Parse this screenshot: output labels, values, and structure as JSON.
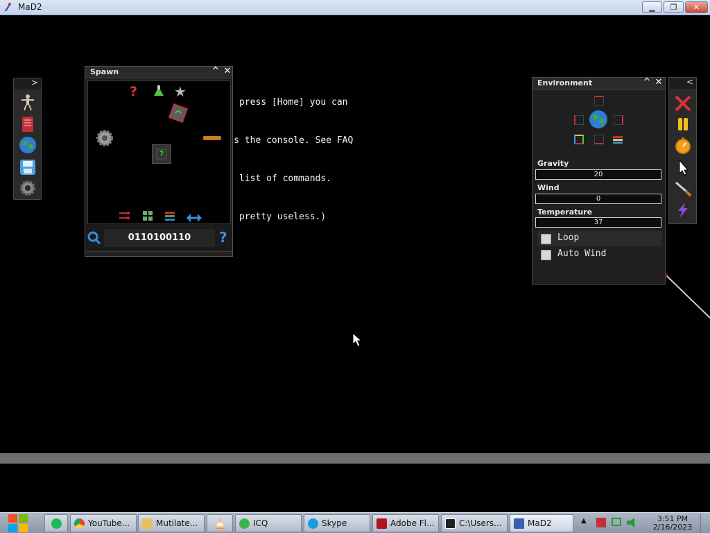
{
  "window": {
    "title": "MaD2",
    "minimize_label": "▁",
    "restore_label": "❐",
    "close_label": "✕"
  },
  "console_hint": {
    "lines": [
      "   ou press [Home] you can",
      "access the console. See FAQ",
      "for a list of commands.",
      "(It's pretty useless.)"
    ]
  },
  "left_toolbar": {
    "collapse_glyph": ">",
    "tools": [
      "ragdoll-tool-icon",
      "notebook-icon",
      "globe-icon",
      "save-disk-icon",
      "gear-icon"
    ]
  },
  "spawn_panel": {
    "title": "Spawn",
    "minimize_glyph": "^",
    "close_glyph": "✕",
    "search_code": "0110100110",
    "help_glyph": "?",
    "spawn_items": [
      "random-question-icon",
      "potion-flask-icon",
      "star-icon",
      "dice-box-icon",
      "gear-object-icon",
      "stick-object-icon",
      "mystery-box-icon"
    ],
    "footer_buttons": [
      "shuffle-icon",
      "grid-icon",
      "list-icon",
      "swap-arrows-icon"
    ]
  },
  "environment_panel": {
    "title": "Environment",
    "minimize_glyph": "^",
    "close_glyph": "✕",
    "gravity_label": "Gravity",
    "gravity_value": "20",
    "wind_label": "Wind",
    "wind_value": "0",
    "temperature_label": "Temperature",
    "temperature_value": "37",
    "loop_label": "Loop",
    "auto_wind_label": "Auto Wind"
  },
  "right_toolbar": {
    "collapse_glyph": "<",
    "tools": [
      "delete-x-icon",
      "pause-icon",
      "stopwatch-icon",
      "pointer-cursor-icon",
      "knife-icon",
      "lightning-icon"
    ]
  },
  "taskbar": {
    "items": [
      {
        "label": "",
        "icon": "spotify-icon",
        "color": "#1db954"
      },
      {
        "label": "YouTube...",
        "icon": "chrome-icon",
        "color": "#dd4b39"
      },
      {
        "label": "Mutilate...",
        "icon": "folder-icon",
        "color": "#e6c35a"
      },
      {
        "label": "",
        "icon": "vlc-icon",
        "color": "#f08a1c"
      },
      {
        "label": "ICQ",
        "icon": "icq-icon",
        "color": "#39b54a"
      },
      {
        "label": "Skype",
        "icon": "skype-icon",
        "color": "#1b9be0"
      },
      {
        "label": "Adobe Fl...",
        "icon": "flash-icon",
        "color": "#b3131b"
      },
      {
        "label": "C:\\Users...",
        "icon": "7zip-icon",
        "color": "#222222"
      },
      {
        "label": "MaD2",
        "icon": "mad2-icon",
        "color": "#3a5fae"
      }
    ],
    "time": "3:51 PM",
    "date": "2/16/2023"
  }
}
